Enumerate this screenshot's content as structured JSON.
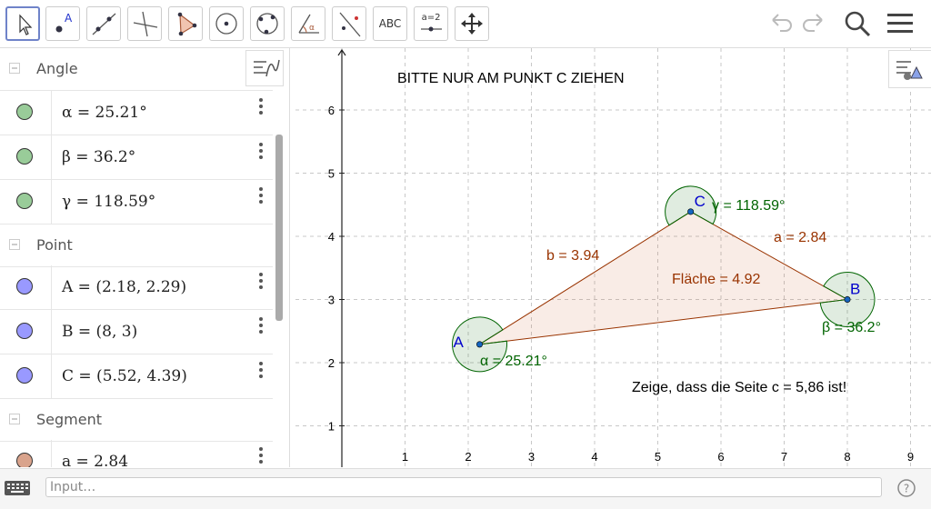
{
  "toolbar": {
    "tools": [
      {
        "name": "move-tool",
        "label": ""
      },
      {
        "name": "point-tool",
        "label": "A"
      },
      {
        "name": "line-tool",
        "label": ""
      },
      {
        "name": "perpendicular-tool",
        "label": ""
      },
      {
        "name": "polygon-tool",
        "label": ""
      },
      {
        "name": "circle-tool",
        "label": ""
      },
      {
        "name": "conic-tool",
        "label": ""
      },
      {
        "name": "angle-tool",
        "label": "α"
      },
      {
        "name": "reflect-tool",
        "label": ""
      },
      {
        "name": "text-tool",
        "label": "ABC"
      },
      {
        "name": "slider-tool",
        "label": "a=2"
      },
      {
        "name": "move-graphics-tool",
        "label": ""
      }
    ]
  },
  "algebra": {
    "sections": [
      {
        "title": "Angle",
        "items": [
          {
            "expr": "α = 25.21°",
            "color": "#99cc99"
          },
          {
            "expr": "β = 36.2°",
            "color": "#99cc99"
          },
          {
            "expr": "γ = 118.59°",
            "color": "#99cc99"
          }
        ]
      },
      {
        "title": "Point",
        "items": [
          {
            "expr": "A = (2.18, 2.29)",
            "color": "#9999ff"
          },
          {
            "expr": "B = (8, 3)",
            "color": "#9999ff"
          },
          {
            "expr": "C = (5.52, 4.39)",
            "color": "#9999ff"
          }
        ]
      },
      {
        "title": "Segment",
        "items": [
          {
            "expr": "a = 2.84",
            "color": "#d9a38c"
          }
        ]
      }
    ]
  },
  "graphics": {
    "title_text": "BITTE NUR AM PUNKT C ZIEHEN",
    "task_text": "Zeige, dass die Seite c = 5,86 ist!",
    "x_ticks": [
      "1",
      "2",
      "3",
      "4",
      "5",
      "6",
      "7",
      "8",
      "9"
    ],
    "y_ticks": [
      "1",
      "2",
      "3",
      "4",
      "5",
      "6"
    ],
    "points": [
      {
        "label": "A",
        "x": 2.18,
        "y": 2.29
      },
      {
        "label": "B",
        "x": 8,
        "y": 3
      },
      {
        "label": "C",
        "x": 5.52,
        "y": 4.39
      }
    ],
    "labels": {
      "a": "a = 2.84",
      "b": "b = 3.94",
      "area": "Fläche = 4.92",
      "alpha": "α = 25.21°",
      "beta": "β = 36.2°",
      "gamma": "γ = 118.59°"
    }
  },
  "input": {
    "placeholder": "Input…"
  }
}
